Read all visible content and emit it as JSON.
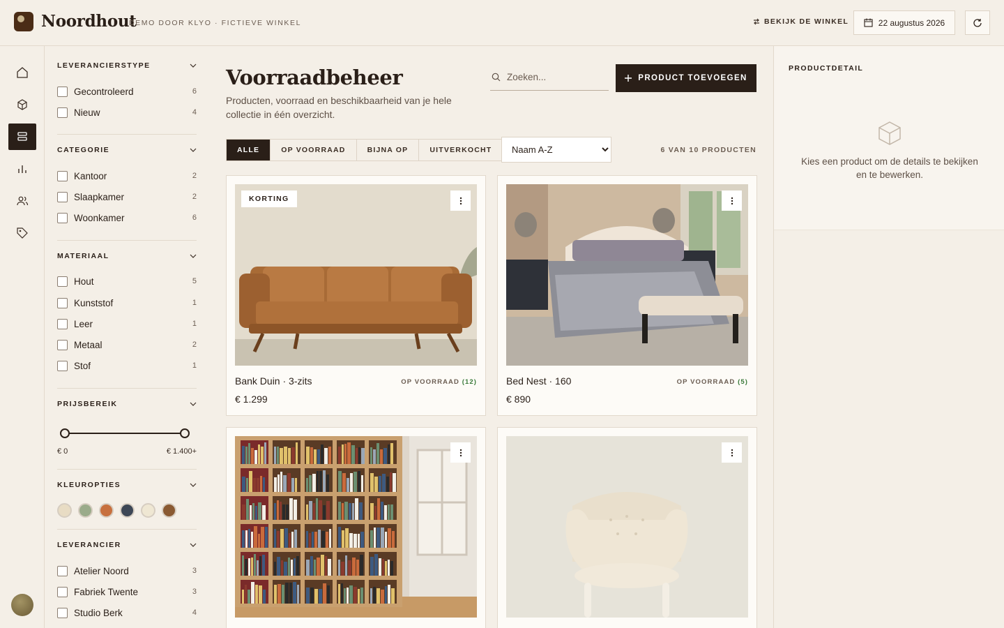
{
  "header": {
    "brand": "Noordhout",
    "subtitle": "DEMO DOOR KLYO · FICTIEVE WINKEL",
    "view_shop": "BEKIJK DE WINKEL",
    "date": "22 augustus 2026"
  },
  "rail": {
    "items": [
      "home-icon",
      "box-icon",
      "layers-icon",
      "chart-icon",
      "users-icon",
      "tag-icon"
    ],
    "active_index": 2
  },
  "filters": {
    "supplier_type": {
      "title": "LEVERANCIERSTYPE",
      "options": [
        {
          "label": "Gecontroleerd",
          "count": "6"
        },
        {
          "label": "Nieuw",
          "count": "4"
        }
      ]
    },
    "category": {
      "title": "CATEGORIE",
      "options": [
        {
          "label": "Kantoor",
          "count": "2"
        },
        {
          "label": "Slaapkamer",
          "count": "2"
        },
        {
          "label": "Woonkamer",
          "count": "6"
        }
      ]
    },
    "material": {
      "title": "MATERIAAL",
      "options": [
        {
          "label": "Hout",
          "count": "5"
        },
        {
          "label": "Kunststof",
          "count": "1"
        },
        {
          "label": "Leer",
          "count": "1"
        },
        {
          "label": "Metaal",
          "count": "2"
        },
        {
          "label": "Stof",
          "count": "1"
        }
      ]
    },
    "price": {
      "title": "PRIJSBEREIK",
      "min_label": "€ 0",
      "max_label": "€ 1.400+",
      "min_fraction": 0,
      "max_fraction": 1
    },
    "colors": {
      "title": "KLEUROPTIES",
      "swatches": [
        "#e8dcc4",
        "#9aab8a",
        "#c7703e",
        "#3d4756",
        "#efe7d3",
        "#8a5a32"
      ]
    },
    "supplier": {
      "title": "LEVERANCIER",
      "options": [
        {
          "label": "Atelier Noord",
          "count": "3"
        },
        {
          "label": "Fabriek Twente",
          "count": "3"
        },
        {
          "label": "Studio Berk",
          "count": "4"
        }
      ]
    }
  },
  "main": {
    "title": "Voorraadbeheer",
    "description": "Producten, voorraad en beschikbaarheid van je hele collectie in één overzicht.",
    "search_placeholder": "Zoeken...",
    "add_button": "PRODUCT TOEVOEGEN",
    "tabs": [
      "ALLE",
      "OP VOORRAAD",
      "BIJNA OP",
      "UITVERKOCHT"
    ],
    "active_tab": 0,
    "sort_options": [
      "Naam A-Z"
    ],
    "count_label": "6 VAN 10 PRODUCTEN"
  },
  "products": [
    {
      "name": "Bank Duin · 3-zits",
      "stock_label": "OP VOORRAAD",
      "stock_count": "(12)",
      "price": "€ 1.299",
      "badge": "KORTING",
      "image": "leather-sofa"
    },
    {
      "name": "Bed Nest · 160",
      "stock_label": "OP VOORRAAD",
      "stock_count": "(5)",
      "price": "€ 890",
      "badge": "",
      "image": "bedroom"
    },
    {
      "name": "",
      "stock_label": "",
      "stock_count": "",
      "price": "",
      "badge": "",
      "image": "bookshelf"
    },
    {
      "name": "",
      "stock_label": "",
      "stock_count": "",
      "price": "",
      "badge": "",
      "image": "armchair"
    }
  ],
  "detail": {
    "title": "PRODUCTDETAIL",
    "empty_text": "Kies een product om de details te bekijken en te bewerken."
  }
}
